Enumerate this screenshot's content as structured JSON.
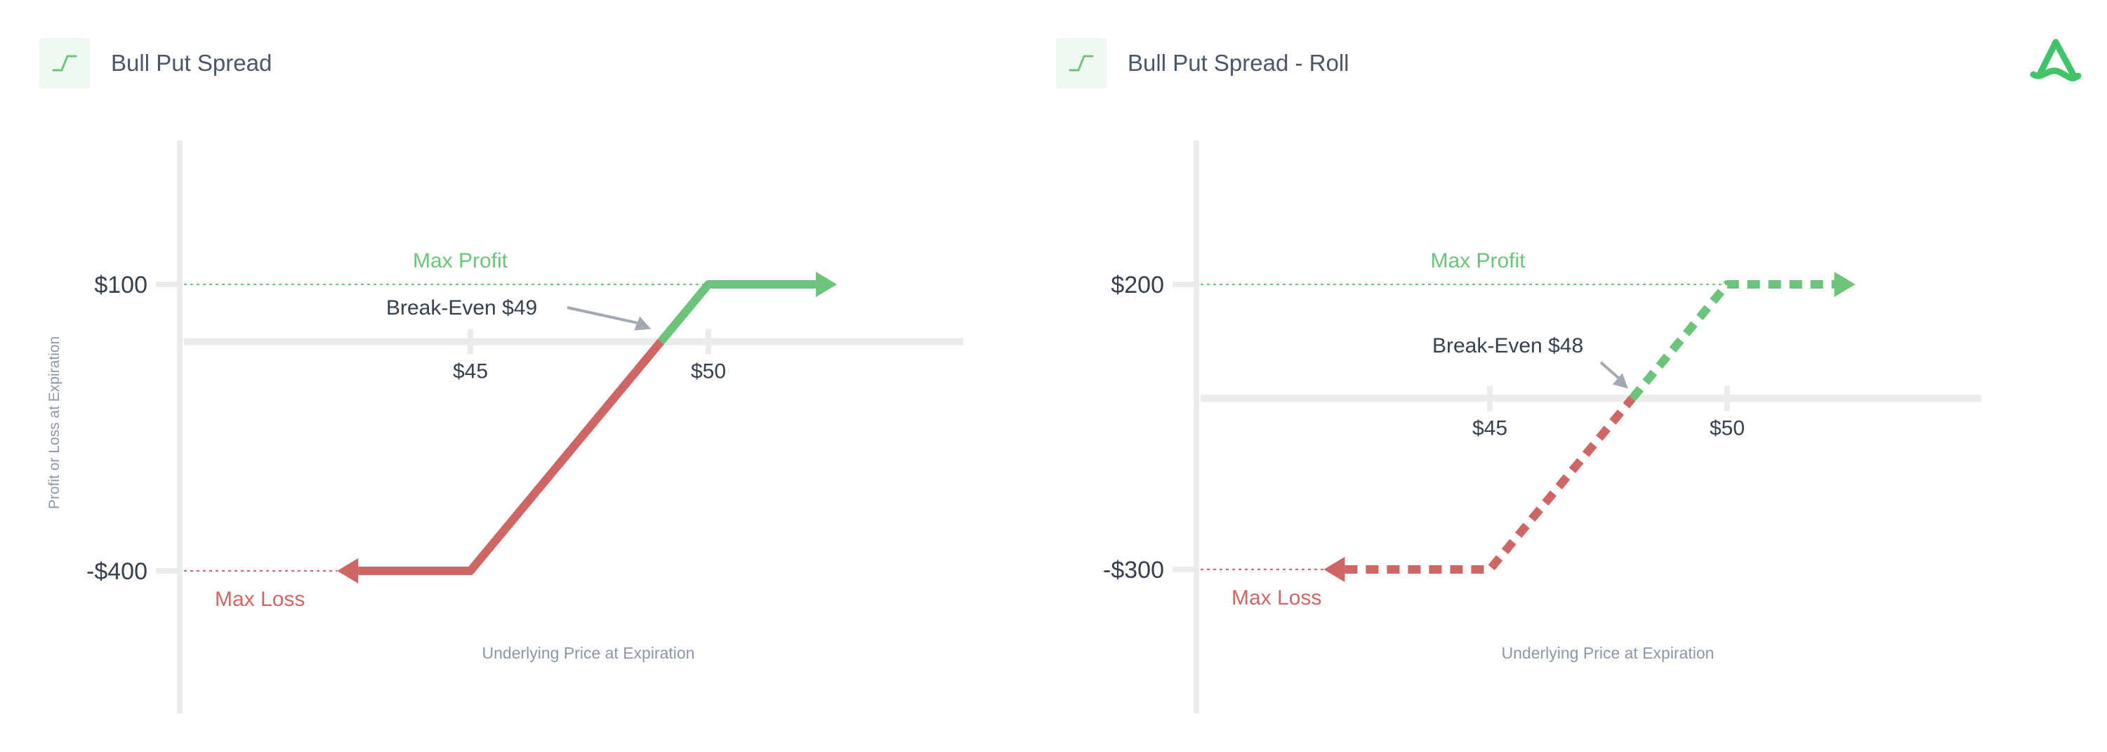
{
  "colors": {
    "profit": "#6cc47b",
    "loss": "#cf6565",
    "axis": "#ebebeb",
    "label_dark": "#35404f",
    "label_grey": "#8c97a6",
    "arrow_grey": "#a3a9b2"
  },
  "logo_icon": "brand-logo-icon",
  "chart_data": [
    {
      "type": "line",
      "title": "Bull Put Spread",
      "icon": "bull-put-spread-icon",
      "xlabel": "Underlying Price at Expiration",
      "ylabel": "Profit or Loss at Expiration",
      "x_ticks": [
        {
          "value": 45,
          "label": "$45"
        },
        {
          "value": 50,
          "label": "$50"
        }
      ],
      "y_ticks": [
        {
          "value": 100,
          "label": "$100"
        },
        {
          "value": -400,
          "label": "-$400"
        }
      ],
      "series": [
        {
          "line_style": "solid",
          "points": [
            {
              "x": 42.2,
              "y": -400
            },
            {
              "x": 45,
              "y": -400
            },
            {
              "x": 49,
              "y": 0
            },
            {
              "x": 50,
              "y": 100
            },
            {
              "x": 52.7,
              "y": 100
            }
          ]
        }
      ],
      "breakeven": {
        "x": 49,
        "label": "Break-Even $49"
      },
      "max_profit": {
        "y": 100,
        "label": "Max Profit"
      },
      "max_loss": {
        "y": -400,
        "label": "Max Loss"
      }
    },
    {
      "type": "line",
      "title": "Bull Put Spread - Roll",
      "icon": "bull-put-spread-icon",
      "xlabel": "Underlying Price at Expiration",
      "ylabel": "",
      "x_ticks": [
        {
          "value": 45,
          "label": "$45"
        },
        {
          "value": 50,
          "label": "$50"
        }
      ],
      "y_ticks": [
        {
          "value": 200,
          "label": "$200"
        },
        {
          "value": -300,
          "label": "-$300"
        }
      ],
      "series": [
        {
          "line_style": "dashed",
          "points": [
            {
              "x": 41.5,
              "y": -300
            },
            {
              "x": 45,
              "y": -300
            },
            {
              "x": 48,
              "y": 0
            },
            {
              "x": 50,
              "y": 200
            },
            {
              "x": 52.7,
              "y": 200
            }
          ]
        }
      ],
      "breakeven": {
        "x": 48,
        "label": "Break-Even $48"
      },
      "max_profit": {
        "y": 200,
        "label": "Max Profit"
      },
      "max_loss": {
        "y": -300,
        "label": "Max Loss"
      }
    }
  ]
}
